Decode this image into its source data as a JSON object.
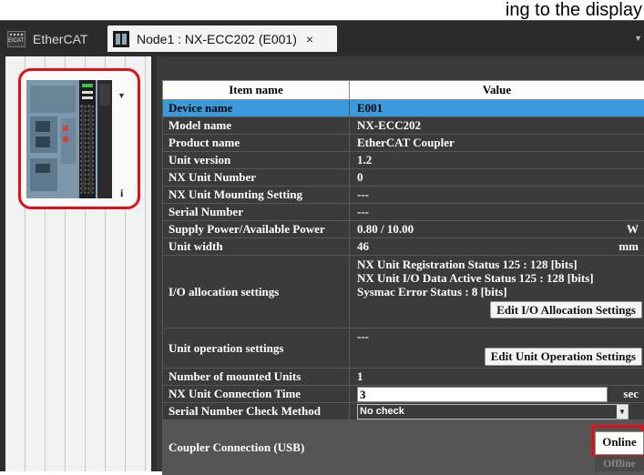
{
  "caption": "ing to the display",
  "tabs": [
    {
      "label": "EtherCAT",
      "icon": "ethercat-icon",
      "active": false
    },
    {
      "label": "Node1 : NX-ECC202 (E001)",
      "icon": "node-icon",
      "active": true,
      "close": "×"
    }
  ],
  "device": {
    "info_glyph": "i"
  },
  "table": {
    "headers": [
      "Item name",
      "Value"
    ],
    "rows": [
      {
        "name": "Device name",
        "value": "E001"
      },
      {
        "name": "Model name",
        "value": "NX-ECC202"
      },
      {
        "name": "Product name",
        "value": "EtherCAT Coupler"
      },
      {
        "name": "Unit version",
        "value": "1.2"
      },
      {
        "name": "NX Unit Number",
        "value": "0"
      },
      {
        "name": "NX Unit Mounting Setting",
        "value": "---"
      },
      {
        "name": "Serial Number",
        "value": "---"
      },
      {
        "name": "Supply Power/Available Power",
        "value": "0.80 / 10.00",
        "unit": "W"
      },
      {
        "name": "Unit width",
        "value": "46",
        "unit": "mm"
      },
      {
        "name": "I/O allocation settings",
        "lines": [
          "NX Unit Registration Status 125 : 128 [bits]",
          "NX Unit I/O Data Active Status 125 : 128 [bits]",
          "Sysmac Error Status : 8 [bits]"
        ],
        "button": "Edit I/O Allocation Settings"
      },
      {
        "name": "Unit operation settings",
        "value": "---",
        "button": "Edit Unit Operation Settings"
      },
      {
        "name": "Number of mounted Units",
        "value": "1"
      },
      {
        "name": "NX Unit Connection Time",
        "value": "3",
        "unit": "sec"
      },
      {
        "name": "Serial Number Check Method",
        "value": "No check"
      },
      {
        "name": "Coupler Connection (USB)",
        "online": "Online",
        "offline": "Offline"
      }
    ]
  }
}
